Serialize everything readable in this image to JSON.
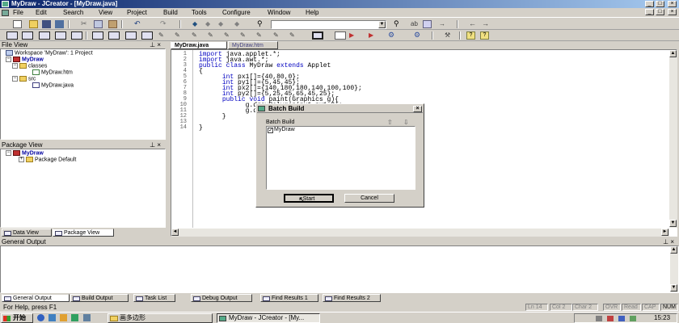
{
  "window": {
    "title": "MyDraw - JCreator - [MyDraw.java]",
    "minimize": "_",
    "maximize": "□",
    "close": "×",
    "doc_minimize": "_",
    "doc_restore": "□",
    "doc_close": "×"
  },
  "menubar": {
    "items": [
      "File",
      "Edit",
      "Search",
      "View",
      "Project",
      "Build",
      "Tools",
      "Configure",
      "Window",
      "Help"
    ]
  },
  "file_view": {
    "header": "File View",
    "pin": "⊥ ×",
    "workspace": "Workspace 'MyDraw': 1 Project",
    "project": "MyDraw",
    "folder_classes": "classes",
    "file_htm": "MyDraw.htm",
    "folder_src": "src",
    "file_java": "MyDraw.java"
  },
  "package_view": {
    "header": "Package View",
    "pin": "⊥ ×",
    "project": "MyDraw",
    "package": "Package Default"
  },
  "left_tabs": {
    "data_view": "Data View",
    "package_view": "Package View"
  },
  "editor": {
    "tabs": [
      "MyDraw.java",
      "MyDraw.htm"
    ],
    "line_numbers": [
      "1",
      "2",
      "3",
      "4",
      "5",
      "6",
      "7",
      "8",
      "9",
      "10",
      "11",
      "12",
      "13",
      "14"
    ],
    "lines": [
      "import java.applet.*;",
      "import java.awt.*;",
      "public class MyDraw extends Applet",
      "{",
      "      int px1[]={40,80,0};",
      "      int py1[]={5,45,45};",
      "      int px2[]={140,180,180,140,100,100};",
      "      int py2[]={5,25,45,65,45,25};",
      "      public void paint(Graphics g){",
      "            g.drawPolygon(px1,px1,3);",
      "            g.d",
      "      }",
      "",
      "}"
    ],
    "keywords": [
      "import",
      "public",
      "class",
      "extends",
      "int",
      "void"
    ]
  },
  "dialog": {
    "title": "Batch Build",
    "close": "×",
    "group_label": "Batch Build",
    "list_item": "MyDraw",
    "checked": true,
    "start_button": "Start",
    "cancel_button": "Cancel"
  },
  "general_output": {
    "header": "General Output",
    "pin": "⊥ ×"
  },
  "output_tabs": [
    "General Output",
    "Build Output",
    "Task List",
    "Debug Output",
    "Find Results 1",
    "Find Results 2"
  ],
  "statusbar": {
    "help": "For Help, press F1",
    "line": "Ln 14",
    "col": "Col 2",
    "char": "Char 2",
    "ovr": "OVR",
    "read": "Read",
    "cap": "CAP",
    "num": "NUM"
  },
  "taskbar": {
    "start": "开始",
    "task1": "画多边形",
    "task2": "MyDraw - JCreator - [My...",
    "clock": "15:23"
  },
  "colors": {
    "keyword": "#0000c0",
    "titlebar_start": "#0a246a",
    "titlebar_end": "#a6caf0",
    "chrome": "#d4d0c8"
  }
}
